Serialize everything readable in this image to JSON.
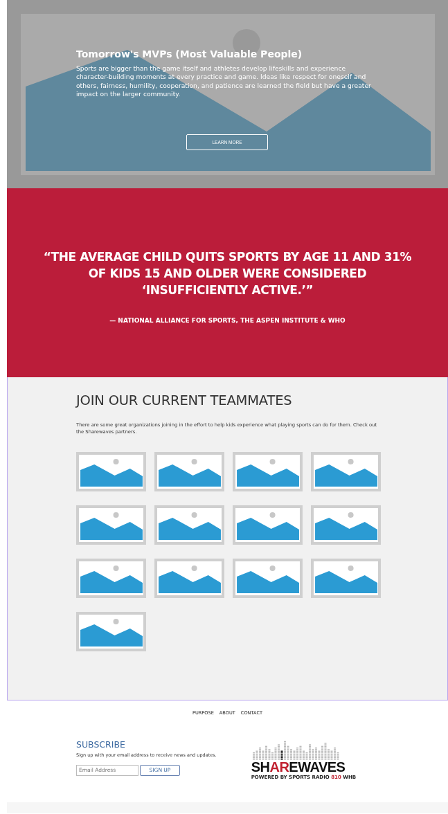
{
  "hero": {
    "title": "Tomorrow's MVPs (Most Valuable People)",
    "text": "Sports are bigger than the game itself and athletes develop lifeskills and experience character-building moments at every practice and game. Ideas like respect for oneself and others, fairness, humility, cooperation, and patience are learned the field but have a greater impact on the larger community.",
    "button": "LEARN MORE"
  },
  "quote": {
    "text": "“THE AVERAGE CHILD QUITS SPORTS BY AGE 11 AND 31% OF KIDS 15 AND OLDER WERE CONSIDERED ‘INSUFFICIENTLY ACTIVE.’”",
    "source": "— NATIONAL ALLIANCE FOR SPORTS, THE ASPEN INSTITUTE & WHO"
  },
  "partners": {
    "title": "JOIN OUR CURRENT TEAMMATES",
    "text": "There are some great organizations joining in the effort to help kids experience what playing sports can do for them. Check out the Sharewaves partners."
  },
  "footer_nav": [
    {
      "label": "PURPOSE"
    },
    {
      "label": "ABOUT"
    },
    {
      "label": "CONTACT"
    }
  ],
  "subscribe": {
    "title": "SUBSCRIBE",
    "text": "Sign up with your email address to receive news and updates.",
    "placeholder": "Email Address",
    "button": "SIGN UP"
  },
  "logo": {
    "name": [
      {
        "text": "SH",
        "accent": false
      },
      {
        "text": "AR",
        "accent": true
      },
      {
        "text": "EWAVES",
        "accent": false
      }
    ],
    "tagline": [
      {
        "text": "POWERED BY SPORTS RADIO ",
        "accent": false
      },
      {
        "text": "810",
        "accent": true
      },
      {
        "text": " WHB",
        "accent": false
      }
    ]
  }
}
